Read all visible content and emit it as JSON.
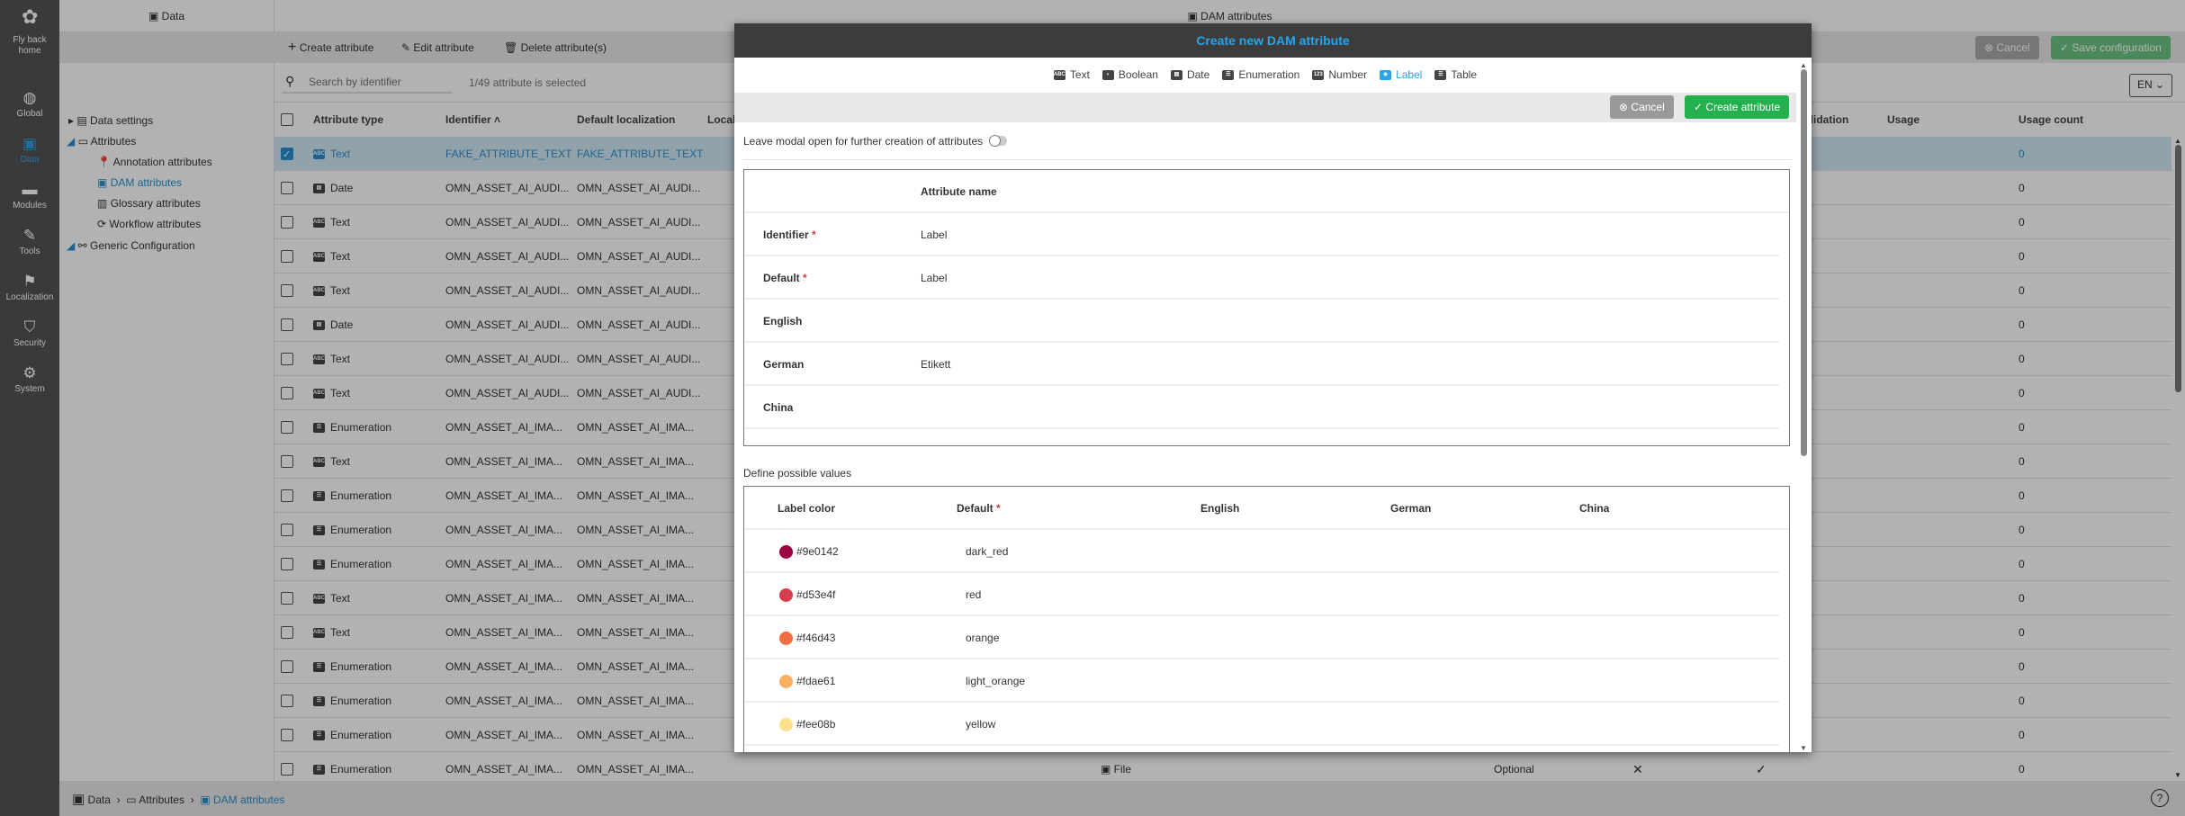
{
  "nav": {
    "home_label": "Fly back home",
    "items": [
      {
        "label": "Global",
        "icon": "globe-icon"
      },
      {
        "label": "Data",
        "icon": "calendar-edit-icon",
        "active": true
      },
      {
        "label": "Modules",
        "icon": "module-icon"
      },
      {
        "label": "Tools",
        "icon": "pencil-icon"
      },
      {
        "label": "Localization",
        "icon": "flag-icon"
      },
      {
        "label": "Security",
        "icon": "shield-icon"
      },
      {
        "label": "System",
        "icon": "gear-icon"
      }
    ]
  },
  "topbar": {
    "left_title": "Data",
    "main_title": "DAM attributes"
  },
  "toolbar": {
    "create": "Create attribute",
    "edit": "Edit attribute",
    "delete": "Delete attribute(s)",
    "cancel": "Cancel",
    "save": "Save configuration"
  },
  "search": {
    "placeholder": "Search by identifier",
    "selection_status": "1/49 attribute is selected",
    "language": "EN"
  },
  "tree": {
    "data_settings": "Data settings",
    "attributes": "Attributes",
    "children": [
      "Annotation attributes",
      "DAM attributes",
      "Glossary attributes",
      "Workflow attributes"
    ],
    "generic": "Generic Configuration"
  },
  "table": {
    "headers": {
      "type": "Attribute type",
      "identifier": "Identifier",
      "default_loc": "Default localization",
      "local": "Local",
      "validation": "alidation",
      "usage": "Usage",
      "usage_count": "Usage count"
    },
    "rows": [
      {
        "type": "Text",
        "identifier": "FAKE_ATTRIBUTE_TEXT",
        "default": "FAKE_ATTRIBUTE_TEXT",
        "count": "0",
        "selected": true
      },
      {
        "type": "Date",
        "identifier": "OMN_ASSET_AI_AUDI...",
        "default": "OMN_ASSET_AI_AUDI...",
        "count": "0"
      },
      {
        "type": "Text",
        "identifier": "OMN_ASSET_AI_AUDI...",
        "default": "OMN_ASSET_AI_AUDI...",
        "count": "0"
      },
      {
        "type": "Text",
        "identifier": "OMN_ASSET_AI_AUDI...",
        "default": "OMN_ASSET_AI_AUDI...",
        "count": "0"
      },
      {
        "type": "Text",
        "identifier": "OMN_ASSET_AI_AUDI...",
        "default": "OMN_ASSET_AI_AUDI...",
        "count": "0"
      },
      {
        "type": "Date",
        "identifier": "OMN_ASSET_AI_AUDI...",
        "default": "OMN_ASSET_AI_AUDI...",
        "count": "0"
      },
      {
        "type": "Text",
        "identifier": "OMN_ASSET_AI_AUDI...",
        "default": "OMN_ASSET_AI_AUDI...",
        "count": "0"
      },
      {
        "type": "Text",
        "identifier": "OMN_ASSET_AI_AUDI...",
        "default": "OMN_ASSET_AI_AUDI...",
        "count": "0"
      },
      {
        "type": "Enumeration",
        "identifier": "OMN_ASSET_AI_IMA...",
        "default": "OMN_ASSET_AI_IMA...",
        "count": "0"
      },
      {
        "type": "Text",
        "identifier": "OMN_ASSET_AI_IMA...",
        "default": "OMN_ASSET_AI_IMA...",
        "count": "0"
      },
      {
        "type": "Enumeration",
        "identifier": "OMN_ASSET_AI_IMA...",
        "default": "OMN_ASSET_AI_IMA...",
        "count": "0"
      },
      {
        "type": "Enumeration",
        "identifier": "OMN_ASSET_AI_IMA...",
        "default": "OMN_ASSET_AI_IMA...",
        "count": "0"
      },
      {
        "type": "Enumeration",
        "identifier": "OMN_ASSET_AI_IMA...",
        "default": "OMN_ASSET_AI_IMA...",
        "count": "0"
      },
      {
        "type": "Text",
        "identifier": "OMN_ASSET_AI_IMA...",
        "default": "OMN_ASSET_AI_IMA...",
        "count": "0"
      },
      {
        "type": "Text",
        "identifier": "OMN_ASSET_AI_IMA...",
        "default": "OMN_ASSET_AI_IMA...",
        "count": "0"
      },
      {
        "type": "Enumeration",
        "identifier": "OMN_ASSET_AI_IMA...",
        "default": "OMN_ASSET_AI_IMA...",
        "count": "0"
      },
      {
        "type": "Enumeration",
        "identifier": "OMN_ASSET_AI_IMA...",
        "default": "OMN_ASSET_AI_IMA...",
        "count": "0"
      },
      {
        "type": "Enumeration",
        "identifier": "OMN_ASSET_AI_IMA...",
        "default": "OMN_ASSET_AI_IMA...",
        "count": "0"
      },
      {
        "type": "Enumeration",
        "identifier": "OMN_ASSET_AI_IMA...",
        "default": "OMN_ASSET_AI_IMA...",
        "count": "0",
        "scope": "File",
        "requirement": "Optional",
        "flag_a": "✕",
        "flag_b": "✓"
      }
    ]
  },
  "breadcrumb": [
    "Data",
    "Attributes",
    "DAM attributes"
  ],
  "modal": {
    "title": "Create new DAM attribute",
    "types": [
      {
        "label": "Text",
        "icon": "ABC"
      },
      {
        "label": "Boolean",
        "icon": "◐"
      },
      {
        "label": "Date",
        "icon": "▤"
      },
      {
        "label": "Enumeration",
        "icon": "☰"
      },
      {
        "label": "Number",
        "icon": "123"
      },
      {
        "label": "Label",
        "icon": "◈",
        "active": true
      },
      {
        "label": "Table",
        "icon": "☰"
      }
    ],
    "cancel": "Cancel",
    "create": "Create attribute",
    "leave_open": "Leave modal open for further creation of attributes",
    "leave_open_on": false,
    "name_header": "Attribute name",
    "fields": [
      {
        "label": "Identifier",
        "required": "*",
        "value": "Label"
      },
      {
        "label": "Default",
        "required": "*",
        "value": "Label"
      },
      {
        "label": "English",
        "value": ""
      },
      {
        "label": "German",
        "value": "Etikett"
      },
      {
        "label": "China",
        "value": ""
      }
    ],
    "values_title": "Define possible values",
    "values_headers": {
      "color": "Label color",
      "default": "Default",
      "required": "*",
      "english": "English",
      "german": "German",
      "china": "China"
    },
    "values": [
      {
        "color": "#9e0142",
        "default": "dark_red"
      },
      {
        "color": "#d53e4f",
        "default": "red"
      },
      {
        "color": "#f46d43",
        "default": "orange"
      },
      {
        "color": "#fdae61",
        "default": "light_orange"
      },
      {
        "color": "#fee08b",
        "default": "yellow"
      }
    ]
  },
  "colors": {
    "accent": "#2aa3e8",
    "success": "#22b14c",
    "selected_row": "#d2e9f5"
  }
}
